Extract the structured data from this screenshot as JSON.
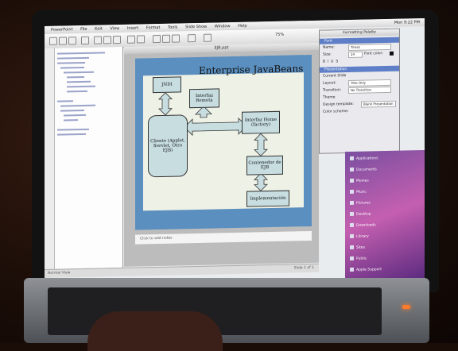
{
  "menubar": {
    "items": [
      "PowerPoint",
      "File",
      "Edit",
      "View",
      "Insert",
      "Format",
      "Tools",
      "Slide Show",
      "Window",
      "Help"
    ],
    "clock": "Mon 9:22 PM"
  },
  "toolbar": {
    "zoom": "75%"
  },
  "window": {
    "title": "EJB.ppt"
  },
  "slide": {
    "title": "Enterprise JavaBeans",
    "boxes": {
      "jndi": "JNDI",
      "remote": "Interfaz Remota",
      "home": "Interfaz Home (factory)",
      "client": "Cliente (Applet, Servlet, Otro EJB)",
      "container": "Contenedor de EJB",
      "impl": "Implementación"
    }
  },
  "notes": {
    "placeholder": "Click to add notes"
  },
  "statusbar": {
    "view": "Normal View",
    "slide": "Slide 1 of 1"
  },
  "palette": {
    "title": "Formatting Palette",
    "font_section": "Font",
    "name_label": "Name:",
    "font_name": "Times",
    "size_label": "Size:",
    "font_size": "24",
    "color_label": "Font color:",
    "presentation_section": "Presentation",
    "current_slide": "Current Slide",
    "layout_label": "Layout:",
    "layout_value": "Title Only",
    "transition_label": "Transition:",
    "transition_value": "No Transition",
    "theme_label": "Theme",
    "design_label": "Design template:",
    "design_value": "Blank Presentation",
    "color_scheme_label": "Color scheme:"
  },
  "desktop": {
    "items": [
      "Applications",
      "Documents",
      "Movies",
      "Music",
      "Pictures",
      "Desktop",
      "Downloads",
      "Library",
      "Sites",
      "Public",
      "Apple Support"
    ]
  },
  "colors": {
    "slide_background": "#5b8fbf",
    "box_fill": "#c7dde0",
    "palette_section": "#5e7fc7",
    "status_led": "#ff7a2a"
  }
}
